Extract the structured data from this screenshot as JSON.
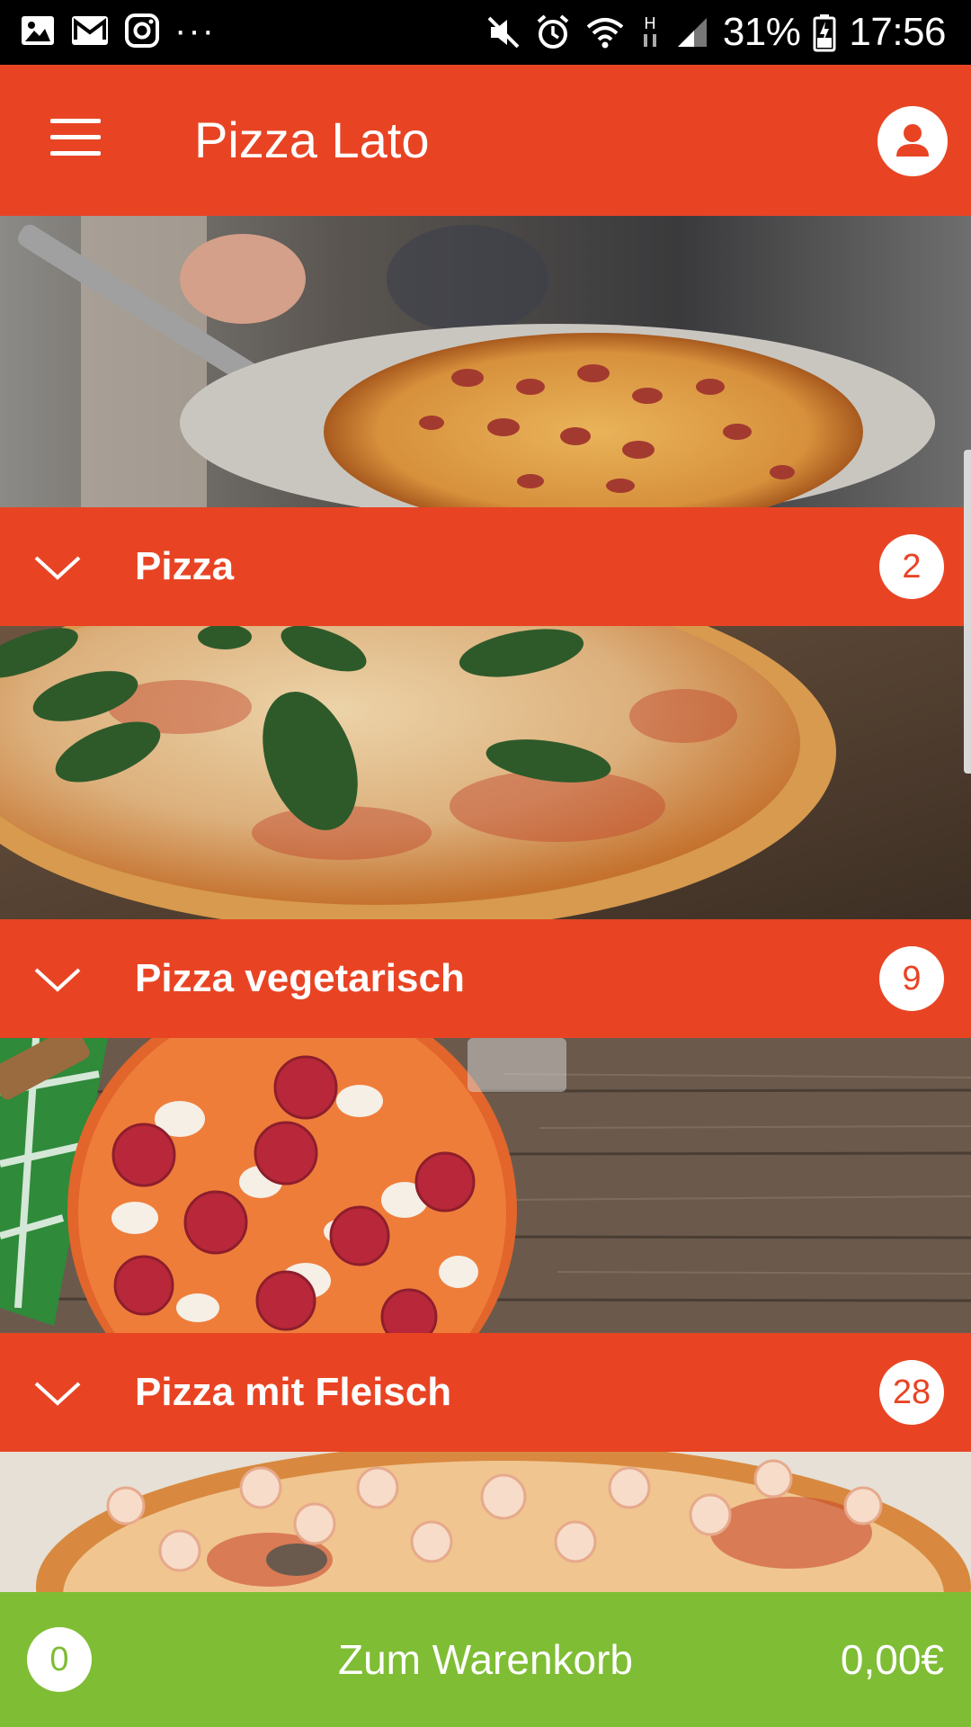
{
  "status_bar": {
    "battery": "31%",
    "time": "17:56",
    "network": "H",
    "left_icons": [
      "image-icon",
      "mail-icon",
      "instagram-icon",
      "more-dots-icon"
    ],
    "right_icons": [
      "mute-icon",
      "alarm-icon",
      "wifi-icon",
      "network-h-icon",
      "signal-icon",
      "battery-icon"
    ]
  },
  "app_bar": {
    "title": "Pizza Lato",
    "menu_icon": "menu-icon",
    "profile_icon": "profile-icon"
  },
  "colors": {
    "primary": "#e84424",
    "cart": "#7fbd35",
    "text_on_primary": "#ffffff"
  },
  "categories": [
    {
      "name": "Pizza",
      "count": "2",
      "image": "margherita-basil-photo"
    },
    {
      "name": "Pizza vegetarisch",
      "count": "9",
      "image": "salami-pizza-wood-photo"
    },
    {
      "name": "Pizza mit Fleisch",
      "count": "28",
      "image": "seafood-pizza-photo"
    }
  ],
  "hero_image": "pizza-peel-oven-photo",
  "cart": {
    "count": "0",
    "label": "Zum Warenkorb",
    "total": "0,00€"
  }
}
